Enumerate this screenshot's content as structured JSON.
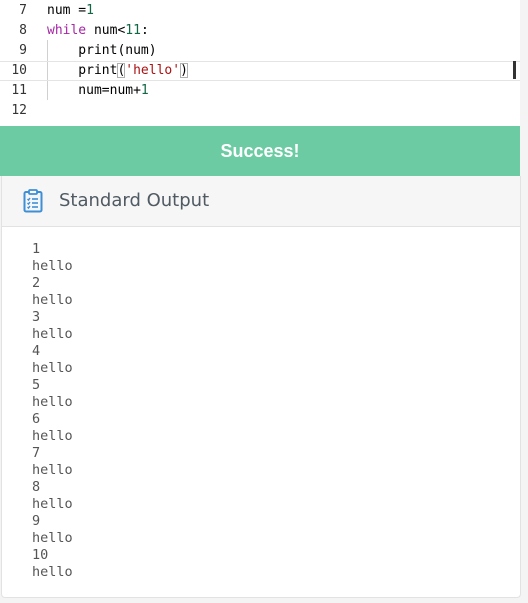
{
  "editor": {
    "lines": [
      {
        "number": "7",
        "tokens": [
          {
            "t": "num =",
            "c": "plain"
          },
          {
            "t": "1",
            "c": "num"
          }
        ]
      },
      {
        "number": "8",
        "tokens": [
          {
            "t": "while",
            "c": "kw"
          },
          {
            "t": " num<",
            "c": "plain"
          },
          {
            "t": "11",
            "c": "num"
          },
          {
            "t": ":",
            "c": "plain"
          }
        ]
      },
      {
        "number": "9",
        "tokens": [
          {
            "t": "    print(num)",
            "c": "plain"
          }
        ]
      },
      {
        "number": "10",
        "tokens": [
          {
            "t": "    print",
            "c": "plain"
          },
          {
            "t": "(",
            "c": "bracket"
          },
          {
            "t": "'hello'",
            "c": "str"
          },
          {
            "t": ")",
            "c": "bracket"
          }
        ]
      },
      {
        "number": "11",
        "tokens": [
          {
            "t": "    num=num+",
            "c": "plain"
          },
          {
            "t": "1",
            "c": "num"
          }
        ]
      },
      {
        "number": "12",
        "tokens": []
      }
    ],
    "active_line_index": 3
  },
  "result": {
    "status_text": "Success!",
    "status_color": "#6ccba2"
  },
  "output": {
    "title": "Standard Output",
    "icon": "clipboard-list-icon",
    "lines": [
      "1",
      "hello",
      "2",
      "hello",
      "3",
      "hello",
      "4",
      "hello",
      "5",
      "hello",
      "6",
      "hello",
      "7",
      "hello",
      "8",
      "hello",
      "9",
      "hello",
      "10",
      "hello"
    ]
  }
}
